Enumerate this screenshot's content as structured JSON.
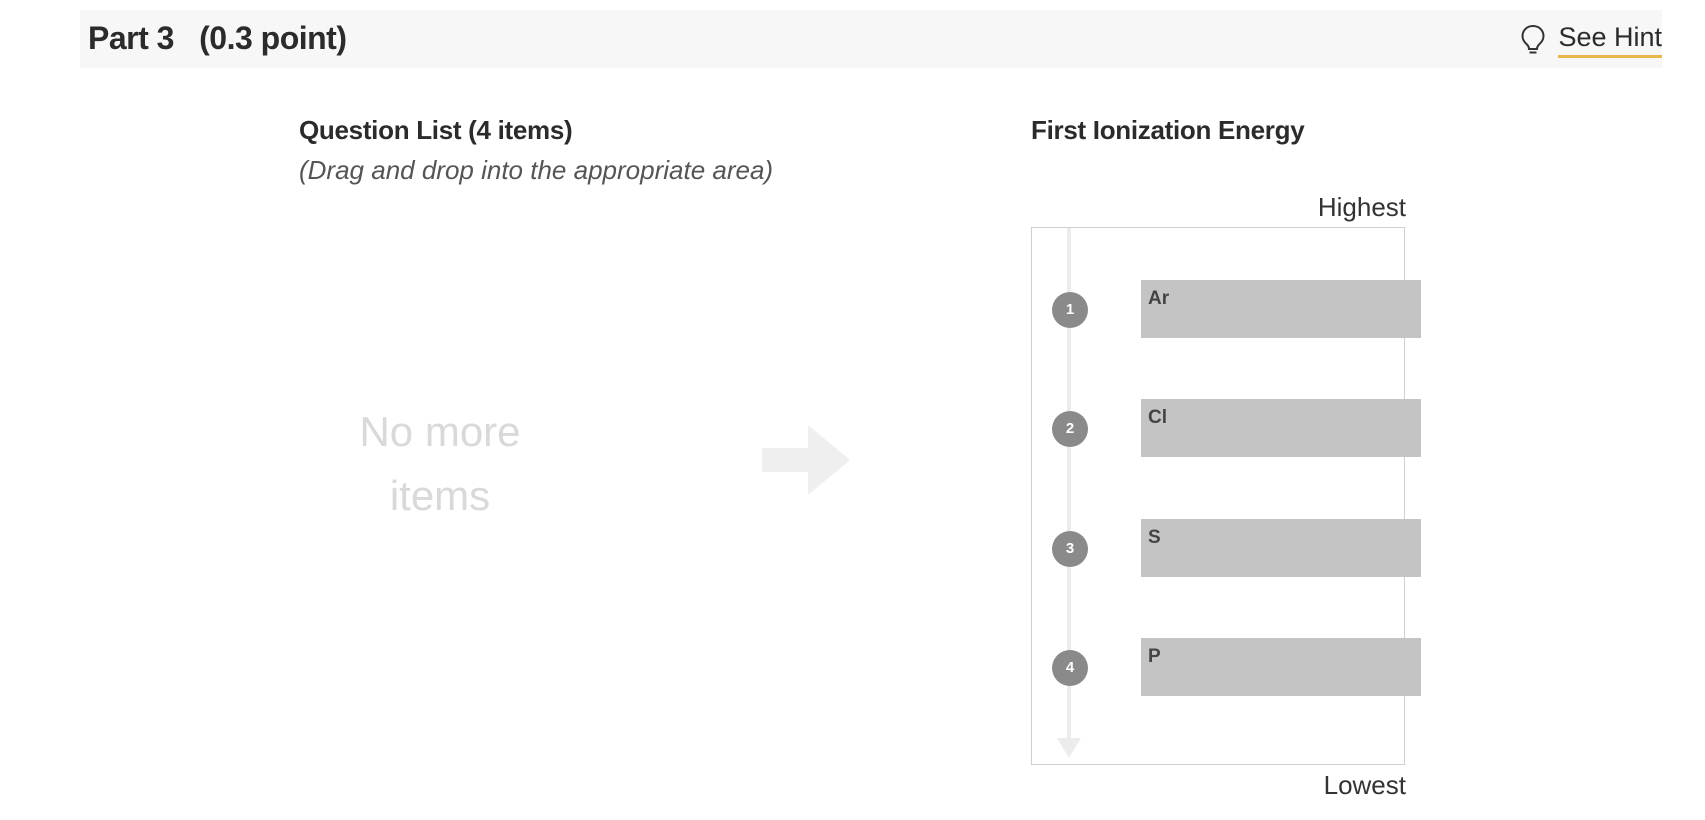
{
  "header": {
    "part_title": "Part 3   (0.3 point)",
    "hint_label": "See Hint",
    "hint_icon": "lightbulb-icon"
  },
  "question_list": {
    "title": "Question List (4 items)",
    "instruction": "(Drag and drop into the appropriate area)",
    "empty_message": "No more items",
    "arrow_icon": "arrow-right-icon"
  },
  "ranking": {
    "title": "First Ionization Energy",
    "top_label": "Highest",
    "bottom_label": "Lowest",
    "items": [
      {
        "rank": "1",
        "label": "Ar"
      },
      {
        "rank": "2",
        "label": "Cl"
      },
      {
        "rank": "3",
        "label": "S"
      },
      {
        "rank": "4",
        "label": "P"
      }
    ]
  },
  "colors": {
    "accent_underline": "#e8b84a",
    "item_background": "#c4c4c4",
    "rank_badge": "#8a8a8a"
  }
}
